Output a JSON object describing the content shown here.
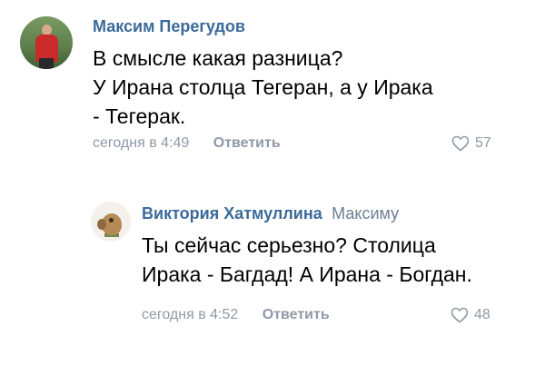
{
  "comments": [
    {
      "author": "Максим Перегудов",
      "text_lines": [
        "В смысле какая разница?",
        "У Ирана столца Тегеран, а у Ирака",
        "- Тегерак."
      ],
      "time": "сегодня в 4:49",
      "reply_label": "Ответить",
      "likes": "57"
    },
    {
      "author": "Виктория Хатмуллина",
      "reply_to": "Максиму",
      "text_lines": [
        "Ты сейчас серьезно? Столица",
        "Ирака - Багдад! А Ирана - Богдан."
      ],
      "time": "сегодня в 4:52",
      "reply_label": "Ответить",
      "likes": "48"
    }
  ],
  "icons": {
    "like": "heart-outline-icon"
  },
  "colors": {
    "author": "#3b6a9a",
    "meta": "#8f99a6",
    "text": "#000000"
  }
}
